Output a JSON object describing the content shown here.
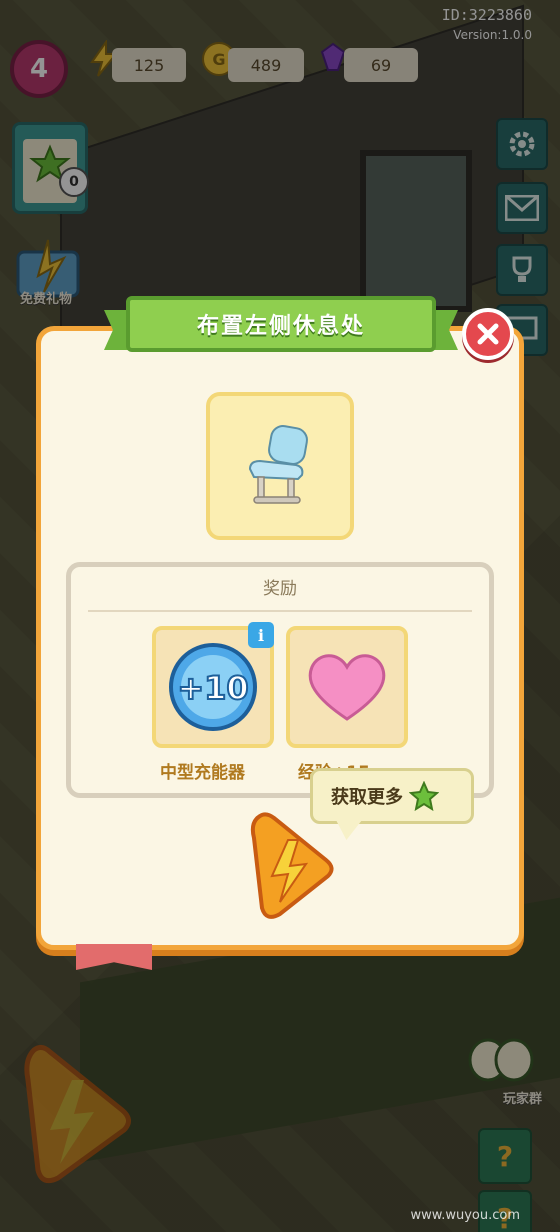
{
  "hud": {
    "level": "4",
    "resources": [
      {
        "icon": "lightning-icon",
        "value": "125"
      },
      {
        "icon": "coin-icon",
        "value": "489"
      },
      {
        "icon": "gem-icon",
        "value": "69"
      }
    ],
    "id_text": "ID:3223860",
    "version_text": "Version:1.0.0"
  },
  "left_panel": {
    "clipboard_count": "0",
    "gift_label": "免费礼物"
  },
  "right_panel": {
    "buttons": [
      "settings-icon",
      "mail-icon",
      "trophy-icon",
      "screen-icon"
    ],
    "group_label": "玩家群"
  },
  "dialog": {
    "title": "布置左侧休息处",
    "item_icon": "chair-icon",
    "reward_header": "奖励",
    "rewards": [
      {
        "icon": "energy-plus-10-icon",
        "badge": "+10",
        "label": "中型充能器",
        "info": "i"
      },
      {
        "icon": "heart-icon",
        "label": "经验+15"
      }
    ],
    "tooltip": "获取更多",
    "colors": {
      "accent_green": "#8fcf4f",
      "panel_bg": "#fbf6e4",
      "border_orange": "#f2a53a",
      "close_red": "#e4484e"
    }
  },
  "footer": {
    "question_mark": "?",
    "watermark": "www.wuyou.com"
  }
}
